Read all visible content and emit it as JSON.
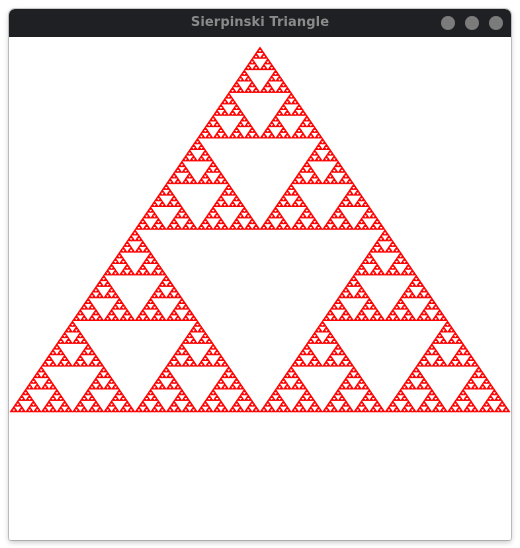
{
  "window": {
    "title": "Sierpinski Triangle",
    "controls": [
      {
        "name": "minimize",
        "icon": "circle-icon"
      },
      {
        "name": "maximize",
        "icon": "circle-icon"
      },
      {
        "name": "close",
        "icon": "circle-icon"
      }
    ]
  },
  "colors": {
    "fractal_fill": "#ff0000",
    "background": "#ffffff",
    "titlebar": "#1f2023",
    "title_text": "#8a8a8a",
    "control": "#7b7b7b"
  }
}
